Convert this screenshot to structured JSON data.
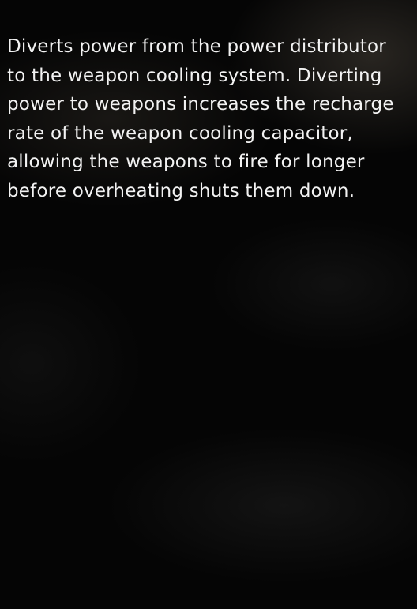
{
  "tooltip": {
    "description": "Diverts power from the power distributor to the weapon cooling system. Diverting power to weapons increases the recharge rate of the weapon cooling capacitor, allowing the weapons to fire for longer before overheating shuts them down."
  }
}
